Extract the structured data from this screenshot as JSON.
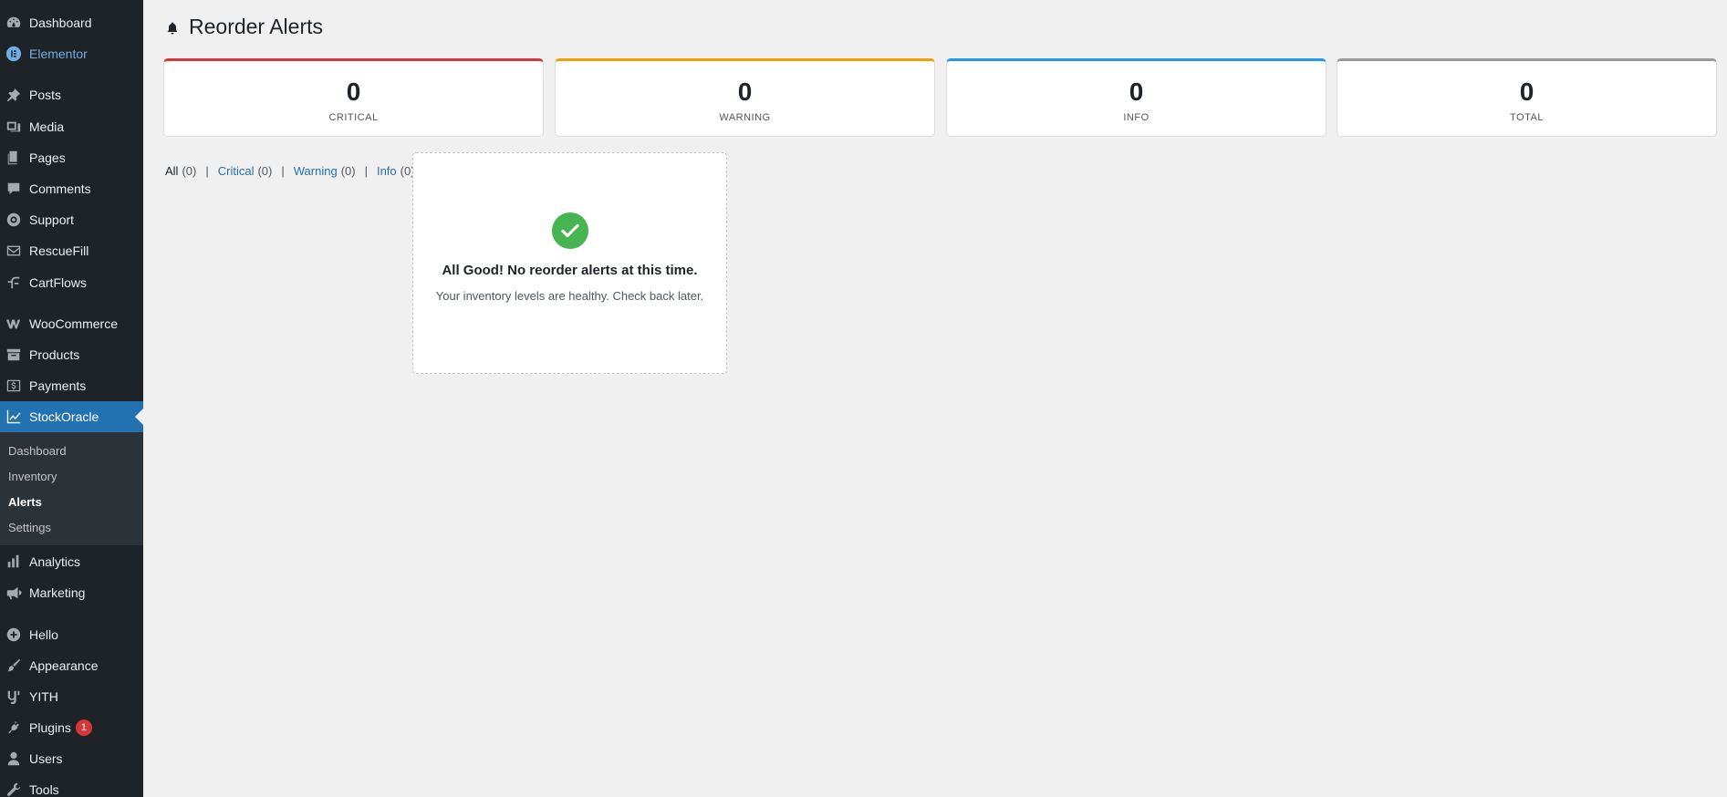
{
  "sidebar": {
    "items": [
      {
        "label": "Dashboard",
        "icon": "dashboard-icon"
      },
      {
        "label": "Elementor",
        "icon": "elementor-icon"
      },
      {
        "label": "Posts",
        "icon": "pin-icon"
      },
      {
        "label": "Media",
        "icon": "media-icon"
      },
      {
        "label": "Pages",
        "icon": "pages-icon"
      },
      {
        "label": "Comments",
        "icon": "comment-icon"
      },
      {
        "label": "Support",
        "icon": "lifebuoy-icon"
      },
      {
        "label": "RescueFill",
        "icon": "envelope-icon"
      },
      {
        "label": "CartFlows",
        "icon": "cartflows-icon"
      },
      {
        "label": "WooCommerce",
        "icon": "woocommerce-icon"
      },
      {
        "label": "Products",
        "icon": "archive-icon"
      },
      {
        "label": "Payments",
        "icon": "dollar-icon"
      },
      {
        "label": "StockOracle",
        "icon": "chart-line-icon"
      },
      {
        "label": "Analytics",
        "icon": "bar-chart-icon"
      },
      {
        "label": "Marketing",
        "icon": "megaphone-icon"
      },
      {
        "label": "Hello",
        "icon": "plus-circle-icon"
      },
      {
        "label": "Appearance",
        "icon": "brush-icon"
      },
      {
        "label": "YITH",
        "icon": "yith-icon"
      },
      {
        "label": "Plugins",
        "icon": "plug-icon",
        "badge": "1"
      },
      {
        "label": "Users",
        "icon": "user-icon"
      },
      {
        "label": "Tools",
        "icon": "wrench-icon"
      }
    ],
    "submenu": [
      {
        "label": "Dashboard"
      },
      {
        "label": "Inventory"
      },
      {
        "label": "Alerts"
      },
      {
        "label": "Settings"
      }
    ]
  },
  "page": {
    "title": "Reorder Alerts",
    "icon": "bell-icon"
  },
  "stats": [
    {
      "value": "0",
      "label": "CRITICAL",
      "color": "#d63638"
    },
    {
      "value": "0",
      "label": "WARNING",
      "color": "#f0a000"
    },
    {
      "value": "0",
      "label": "INFO",
      "color": "#2196f3"
    },
    {
      "value": "0",
      "label": "TOTAL",
      "color": "#999999"
    }
  ],
  "filters": [
    {
      "label": "All",
      "count": "(0)"
    },
    {
      "label": "Critical",
      "count": "(0)"
    },
    {
      "label": "Warning",
      "count": "(0)"
    },
    {
      "label": "Info",
      "count": "(0)"
    }
  ],
  "filter_separator": "|",
  "empty_state": {
    "icon": "check-circle-icon",
    "title": "All Good! No reorder alerts at this time.",
    "text": "Your inventory levels are healthy. Check back later."
  },
  "colors": {
    "sidebar_bg": "#1d2327",
    "active_bg": "#2271b1",
    "link": "#2271b1",
    "success": "#46b450"
  }
}
